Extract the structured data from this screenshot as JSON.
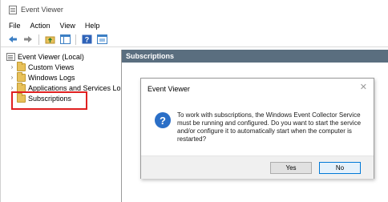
{
  "window": {
    "title": "Event Viewer"
  },
  "menu": [
    "File",
    "Action",
    "View",
    "Help"
  ],
  "toolbar": {
    "buttons": [
      "back-arrow-icon",
      "forward-arrow-icon",
      "up-folder-icon",
      "show-hide-tree-icon",
      "help-icon",
      "properties-icon"
    ]
  },
  "tree": {
    "root": "Event Viewer (Local)",
    "items": [
      {
        "label": "Custom Views",
        "icon": "folder-icon"
      },
      {
        "label": "Windows Logs",
        "icon": "folder-icon"
      },
      {
        "label": "Applications and Services Lo",
        "icon": "folder-icon"
      },
      {
        "label": "Subscriptions",
        "icon": "subscriptions-icon",
        "highlighted": true
      }
    ]
  },
  "right_pane": {
    "header": "Subscriptions"
  },
  "dialog": {
    "title": "Event Viewer",
    "icon": "question-icon",
    "message": "To work with subscriptions, the Windows Event Collector Service must be running and configured.  Do you want to start the service and/or configure it to automatically start when the computer is restarted?",
    "buttons": {
      "yes": "Yes",
      "no": "No"
    }
  },
  "colors": {
    "pane_header_bg": "#5a6e7f",
    "highlight_border": "#e02020",
    "question_icon": "#2b6fc7",
    "default_button_border": "#0078d7"
  }
}
